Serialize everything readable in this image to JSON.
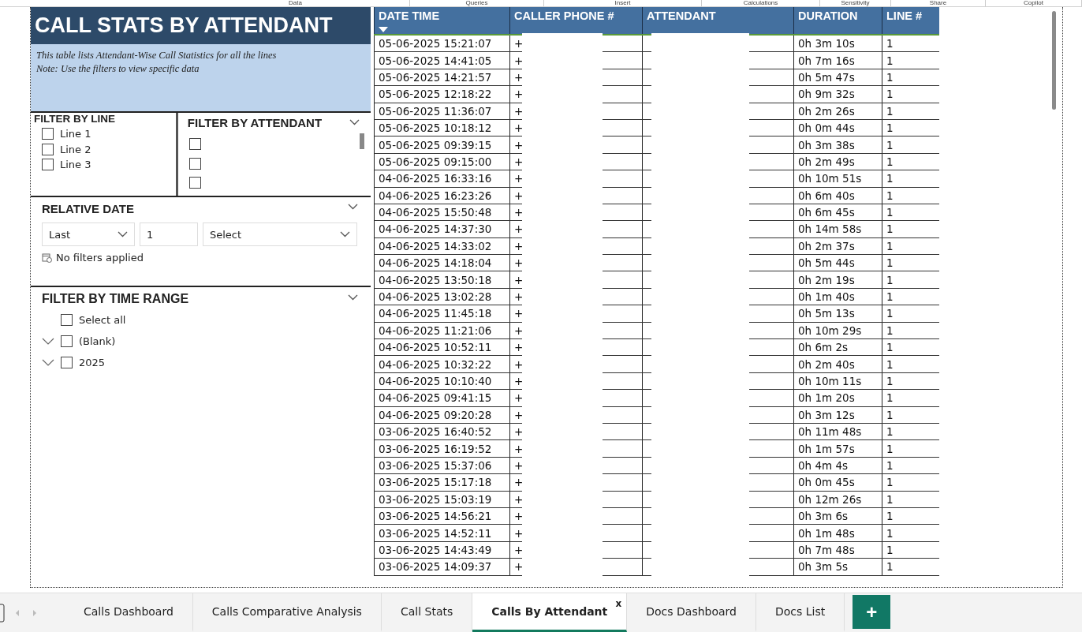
{
  "ribbon": [
    "Data",
    "Queries",
    "Insert",
    "Calculations",
    "Sensitivity",
    "Share",
    "Copilot"
  ],
  "title": "CALL STATS BY ATTENDANT",
  "description": [
    "This table lists Attendant-Wise Call Statistics for all the lines",
    "Note:  Use the filters to view specific data"
  ],
  "filter_by_line": {
    "title": "FILTER BY LINE",
    "items": [
      {
        "label": "Line 1",
        "checked": false
      },
      {
        "label": "Line 2",
        "checked": false
      },
      {
        "label": "Line 3",
        "checked": false
      }
    ]
  },
  "filter_by_attendant": {
    "title": "FILTER BY ATTENDANT",
    "items": [
      {
        "checked": false
      },
      {
        "checked": false
      },
      {
        "checked": false
      }
    ]
  },
  "relative_date": {
    "title": "RELATIVE DATE",
    "period": "Last",
    "count": "1",
    "unit": "Select",
    "status": "No filters applied"
  },
  "filter_by_time_range": {
    "title": "FILTER BY TIME RANGE",
    "select_all": {
      "label": "Select all",
      "checked": false
    },
    "items": [
      {
        "label": "(Blank)",
        "checked": false,
        "expanded": false
      },
      {
        "label": "2025",
        "checked": false,
        "expanded": false
      }
    ]
  },
  "table": {
    "columns": [
      {
        "label": "DATE TIME",
        "sorted": true
      },
      {
        "label": "CALLER PHONE #",
        "sorted": false
      },
      {
        "label": "ATTENDANT",
        "sorted": false
      },
      {
        "label": "DURATION",
        "sorted": false
      },
      {
        "label": "LINE #",
        "sorted": false
      }
    ],
    "rows": [
      {
        "date_time": "05-06-2025 15:21:07",
        "phone": "+",
        "duration": "0h 3m 10s",
        "line": "1"
      },
      {
        "date_time": "05-06-2025 14:41:05",
        "phone": "+",
        "duration": "0h 7m 16s",
        "line": "1"
      },
      {
        "date_time": "05-06-2025 14:21:57",
        "phone": "+",
        "duration": "0h 5m 47s",
        "line": "1"
      },
      {
        "date_time": "05-06-2025 12:18:22",
        "phone": "+",
        "duration": "0h 9m 32s",
        "line": "1"
      },
      {
        "date_time": "05-06-2025 11:36:07",
        "phone": "+",
        "duration": "0h 2m 26s",
        "line": "1"
      },
      {
        "date_time": "05-06-2025 10:18:12",
        "phone": "+",
        "duration": "0h 0m 44s",
        "line": "1"
      },
      {
        "date_time": "05-06-2025 09:39:15",
        "phone": "+",
        "duration": "0h 3m 38s",
        "line": "1"
      },
      {
        "date_time": "05-06-2025 09:15:00",
        "phone": "+",
        "duration": "0h 2m 49s",
        "line": "1"
      },
      {
        "date_time": "04-06-2025 16:33:16",
        "phone": "+",
        "duration": "0h 10m 51s",
        "line": "1"
      },
      {
        "date_time": "04-06-2025 16:23:26",
        "phone": "+",
        "duration": "0h 6m 40s",
        "line": "1"
      },
      {
        "date_time": "04-06-2025 15:50:48",
        "phone": "+",
        "duration": "0h 6m 45s",
        "line": "1"
      },
      {
        "date_time": "04-06-2025 14:37:30",
        "phone": "+",
        "duration": "0h 14m 58s",
        "line": "1"
      },
      {
        "date_time": "04-06-2025 14:33:02",
        "phone": "+",
        "duration": "0h 2m 37s",
        "line": "1"
      },
      {
        "date_time": "04-06-2025 14:18:04",
        "phone": "+",
        "duration": "0h 5m 44s",
        "line": "1"
      },
      {
        "date_time": "04-06-2025 13:50:18",
        "phone": "+",
        "duration": "0h 2m 19s",
        "line": "1"
      },
      {
        "date_time": "04-06-2025 13:02:28",
        "phone": "+",
        "duration": "0h 1m 40s",
        "line": "1"
      },
      {
        "date_time": "04-06-2025 11:45:18",
        "phone": "+",
        "duration": "0h 5m 13s",
        "line": "1"
      },
      {
        "date_time": "04-06-2025 11:21:06",
        "phone": "+",
        "duration": "0h 10m 29s",
        "line": "1"
      },
      {
        "date_time": "04-06-2025 10:52:11",
        "phone": "+",
        "duration": "0h 6m 2s",
        "line": "1"
      },
      {
        "date_time": "04-06-2025 10:32:22",
        "phone": "+",
        "duration": "0h 2m 40s",
        "line": "1"
      },
      {
        "date_time": "04-06-2025 10:10:40",
        "phone": "+",
        "duration": "0h 10m 11s",
        "line": "1"
      },
      {
        "date_time": "04-06-2025 09:41:15",
        "phone": "+",
        "duration": "0h 1m 20s",
        "line": "1"
      },
      {
        "date_time": "04-06-2025 09:20:28",
        "phone": "+",
        "duration": "0h 3m 12s",
        "line": "1"
      },
      {
        "date_time": "03-06-2025 16:40:52",
        "phone": "+",
        "duration": "0h 11m 48s",
        "line": "1"
      },
      {
        "date_time": "03-06-2025 16:19:52",
        "phone": "+",
        "duration": "0h 1m 57s",
        "line": "1"
      },
      {
        "date_time": "03-06-2025 15:37:06",
        "phone": "+",
        "duration": "0h 4m 4s",
        "line": "1"
      },
      {
        "date_time": "03-06-2025 15:17:18",
        "phone": "+",
        "duration": "0h 0m 45s",
        "line": "1"
      },
      {
        "date_time": "03-06-2025 15:03:19",
        "phone": "+",
        "duration": "0h 12m 26s",
        "line": "1"
      },
      {
        "date_time": "03-06-2025 14:56:21",
        "phone": "+",
        "duration": "0h 3m 6s",
        "line": "1"
      },
      {
        "date_time": "03-06-2025 14:52:11",
        "phone": "+",
        "duration": "0h 1m 48s",
        "line": "1"
      },
      {
        "date_time": "03-06-2025 14:43:49",
        "phone": "+",
        "duration": "0h 7m 48s",
        "line": "1"
      },
      {
        "date_time": "03-06-2025 14:09:37",
        "phone": "+",
        "duration": "0h 3m 5s",
        "line": "1"
      }
    ]
  },
  "sheet_tabs": [
    {
      "label": "Calls Dashboard",
      "selected": false
    },
    {
      "label": "Calls Comparative Analysis",
      "selected": false
    },
    {
      "label": "Call Stats",
      "selected": false
    },
    {
      "label": "Calls By Attendant",
      "selected": true
    },
    {
      "label": "Docs Dashboard",
      "selected": false
    },
    {
      "label": "Docs List",
      "selected": false
    }
  ],
  "close_mark": "x",
  "add_tab": "+"
}
